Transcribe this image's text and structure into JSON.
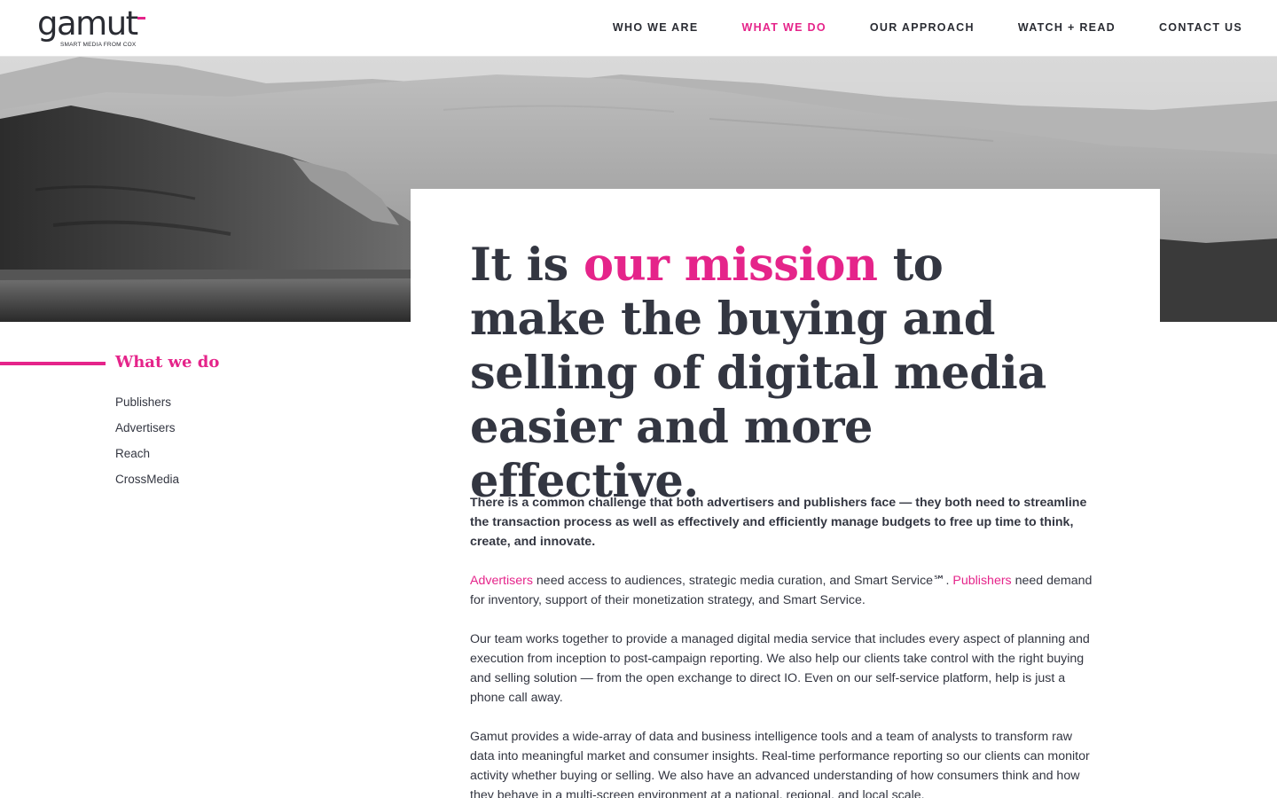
{
  "brand": {
    "name": "gamut",
    "tagline": "SMART MEDIA FROM COX",
    "accent_color": "#e5248a",
    "text_color": "#333641"
  },
  "nav": {
    "items": [
      {
        "label": "WHO WE ARE",
        "active": false
      },
      {
        "label": "WHAT WE DO",
        "active": true
      },
      {
        "label": "OUR APPROACH",
        "active": false
      },
      {
        "label": "WATCH + READ",
        "active": false
      },
      {
        "label": "CONTACT US",
        "active": false
      }
    ]
  },
  "hero": {
    "image": "black-and-white coastal hills landscape"
  },
  "sidebar": {
    "title": "What we do",
    "items": [
      "Publishers",
      "Advertisers",
      "Reach",
      "CrossMedia"
    ]
  },
  "main": {
    "headline": {
      "before": "It is ",
      "accent": "our mission",
      "after": " to make the buying and selling of digital media easier and more effective."
    },
    "lead": "There is a common challenge that both advertisers and publishers face — they both need to streamline the transaction process as well as effectively and efficiently manage budgets to free up time to think, create, and innovate.",
    "p1": {
      "link1": "Advertisers",
      "text1": " need access to audiences, strategic media curation, and Smart Service℠. ",
      "link2": "Publishers",
      "text2": " need demand for inventory, support of their monetization strategy, and Smart Service."
    },
    "p2": "Our team works together to provide a managed digital media service that includes every aspect of planning and execution from inception to post-campaign reporting. We also help our clients take control with the right buying and selling solution — from the open exchange to direct IO. Even on our self-service platform, help is just a phone call away.",
    "p3": "Gamut provides a wide-array of data and business intelligence tools and a team of analysts to transform raw data into meaningful market and consumer insights.  Real-time performance reporting so our clients can monitor activity whether buying or selling.  We also have an advanced understanding of how consumers think and how they behave in a multi-screen environment at a national, regional, and local scale."
  }
}
